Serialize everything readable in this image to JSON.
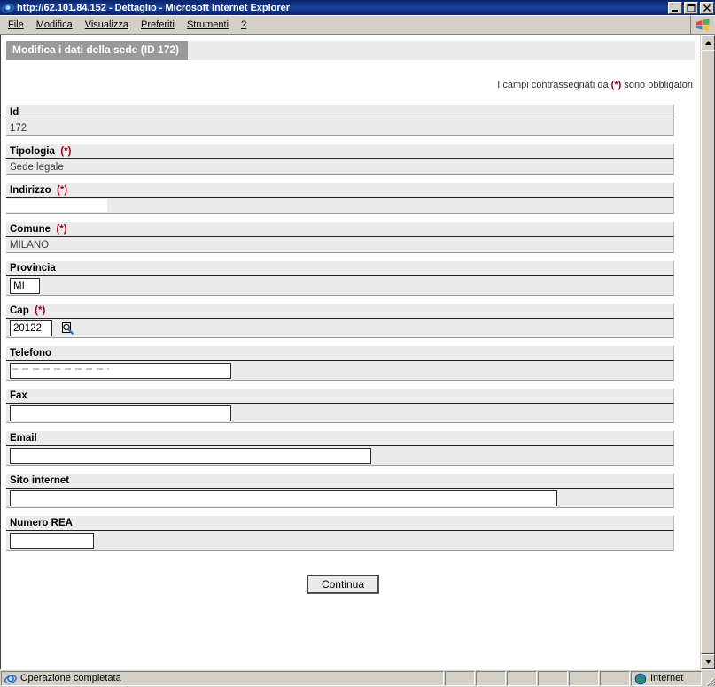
{
  "window": {
    "title": "http://62.101.84.152 - Dettaglio - Microsoft Internet Explorer",
    "icon": "ie-icon",
    "minimize_label": "Riduci a icona",
    "maximize_label": "Ingrandisci",
    "close_label": "Chiudi"
  },
  "menubar": {
    "items": [
      {
        "label": "File",
        "accel": "F"
      },
      {
        "label": "Modifica",
        "accel": "M"
      },
      {
        "label": "Visualizza",
        "accel": "V"
      },
      {
        "label": "Preferiti",
        "accel": "P"
      },
      {
        "label": "Strumenti",
        "accel": "S"
      },
      {
        "label": "?",
        "accel": "?"
      }
    ],
    "logo": "windows-flag-icon"
  },
  "page": {
    "header_title": "Modifica i dati della sede (ID 172)",
    "required_note_before": "I campi contrassegnati da ",
    "required_note_star": "(*)",
    "required_note_after": " sono obbligatori"
  },
  "fields": [
    {
      "label": "Id",
      "required": false,
      "type": "readonly",
      "value": "172"
    },
    {
      "label": "Tipologia",
      "required": true,
      "type": "readonly",
      "value": "Sede legale"
    },
    {
      "label": "Indirizzo",
      "required": true,
      "type": "redacted",
      "value": "-"
    },
    {
      "label": "Comune",
      "required": true,
      "type": "readonly",
      "value": "MILANO"
    },
    {
      "label": "Provincia",
      "required": false,
      "type": "input",
      "value": "MI",
      "size": "small"
    },
    {
      "label": "Cap",
      "required": true,
      "type": "input-search",
      "value": "20122",
      "size": "cap",
      "search_icon": "search-icon"
    },
    {
      "label": "Telefono",
      "required": false,
      "type": "input-redacted",
      "value": "",
      "size": "med"
    },
    {
      "label": "Fax",
      "required": false,
      "type": "input",
      "value": "",
      "size": "med"
    },
    {
      "label": "Email",
      "required": false,
      "type": "input",
      "value": "",
      "size": "email"
    },
    {
      "label": "Sito internet",
      "required": false,
      "type": "input",
      "value": "",
      "size": "site"
    },
    {
      "label": "Numero REA",
      "required": false,
      "type": "input",
      "value": "",
      "size": "rea"
    }
  ],
  "submit": {
    "label": "Continua"
  },
  "statusbar": {
    "message": "Operazione completata",
    "message_icon": "ie-icon",
    "zone_label": "Internet",
    "zone_icon": "globe-icon",
    "panels": [
      "",
      "",
      "",
      "",
      "",
      ""
    ]
  },
  "colors": {
    "titlebar": "#0a246a",
    "required_star": "#9e0016",
    "header_band": "#9a9a9a",
    "field_bg": "#ebebeb",
    "chrome": "#d4d0c8"
  }
}
